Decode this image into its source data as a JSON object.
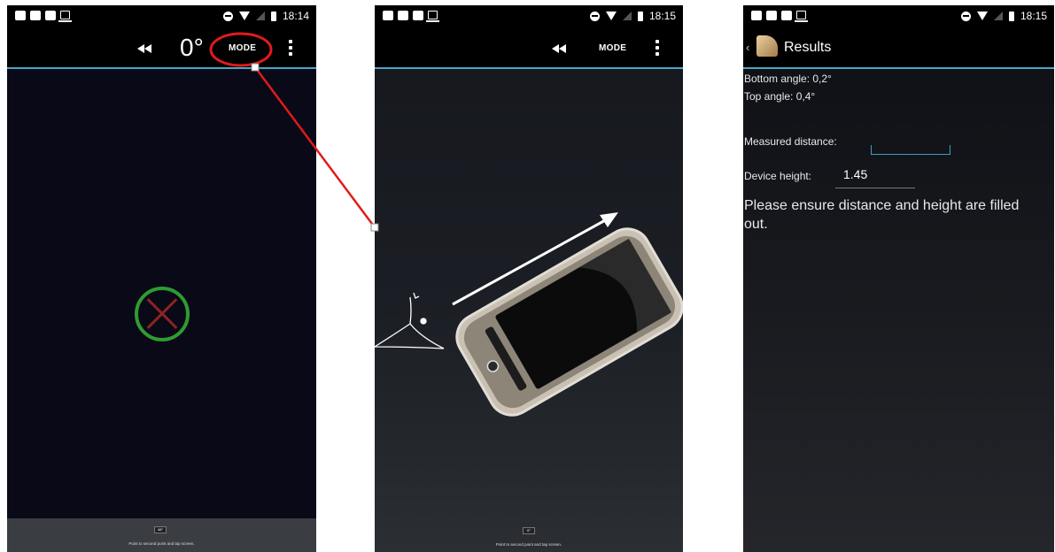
{
  "screens": [
    {
      "status_time": "18:14",
      "actionbar": {
        "angle": "0°",
        "mode_label": "MODE"
      },
      "bottom": {
        "readout": "48°",
        "instruction": "Point to second point and tap screen."
      }
    },
    {
      "status_time": "18:15",
      "actionbar": {
        "mode_label": "MODE"
      },
      "bottom": {
        "readout": "0°",
        "instruction": "Point to second point and tap screen."
      }
    },
    {
      "status_time": "18:15",
      "actionbar": {
        "title": "Results"
      },
      "results": {
        "bottom_angle": "Bottom angle: 0,2°",
        "top_angle": "Top angle: 0,4°",
        "measured_distance_label": "Measured distance:",
        "measured_distance_value": "",
        "device_height_label": "Device height:",
        "device_height_value": "1.45",
        "message": "Please ensure distance and height are filled out."
      }
    }
  ],
  "colors": {
    "accent_line": "#4aa6c6",
    "annotation_red": "#e01b1b",
    "crosshair_circle": "#2e9c31",
    "crosshair_x": "#8d2323"
  },
  "icons": [
    "youtube-icon",
    "camera-icon",
    "gallery-icon",
    "laptop-icon",
    "do-not-disturb-icon",
    "wifi-icon",
    "signal-icon",
    "battery-icon",
    "rewind-icon",
    "overflow-menu-icon",
    "back-chevron-icon",
    "app-logo-icon",
    "crosshair-icon",
    "phone-tilt-illustration",
    "eye-icon",
    "arrow-icon"
  ]
}
